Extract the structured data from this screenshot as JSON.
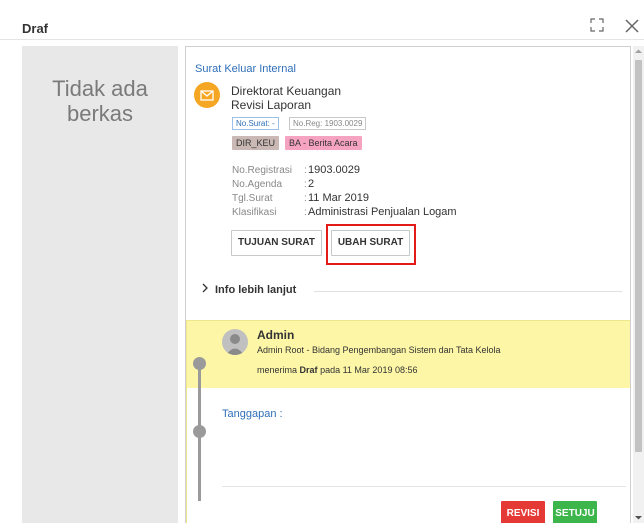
{
  "modal": {
    "title": "Draf"
  },
  "left_panel": {
    "line1": "Tidak ada",
    "line2": "berkas"
  },
  "letter": {
    "type": "Surat Keluar Internal",
    "sender": "Direktorat Keuangan",
    "subject": "Revisi Laporan",
    "tags": {
      "no_surat": "No.Surat: -",
      "no_reg": "No.Reg: 1903.0029"
    },
    "badges": {
      "unit": "DIR_KEU",
      "type": "BA - Berita Acara"
    },
    "meta": [
      {
        "label": "No.Registrasi",
        "value": "1903.0029"
      },
      {
        "label": "No.Agenda",
        "value": "2"
      },
      {
        "label": "Tgl.Surat",
        "value": "11 Mar 2019"
      },
      {
        "label": "Klasifikasi",
        "value": "Administrasi Penjualan Logam"
      }
    ],
    "colon": ":"
  },
  "buttons": {
    "tujuan": "TUJUAN SURAT",
    "ubah": "UBAH SURAT",
    "revisi": "REVISI",
    "setuju": "SETUJU"
  },
  "info_more": "Info lebih lanjut",
  "timeline": {
    "name": "Admin",
    "desc": "Admin Root - Bidang Pengembangan Sistem dan Tata Kelola",
    "receive_prefix": "menerima",
    "receive_status": "Draf",
    "receive_suffix": "pada 11 Mar 2019 08:56",
    "tanggapan": "Tanggapan :"
  },
  "colors": {
    "accent_blue": "#2f6fb8",
    "highlight_red": "#e41a1a",
    "timeline_yellow": "#fcf6a6",
    "revisi_red": "#e53935",
    "setuju_green": "#3cb64a",
    "envelope_orange": "#f5a623"
  },
  "icons": {
    "expand": "expand-icon",
    "close": "close-icon",
    "envelope": "envelope-icon",
    "chevron": "chevron-right-icon",
    "avatar": "user-avatar-icon"
  }
}
